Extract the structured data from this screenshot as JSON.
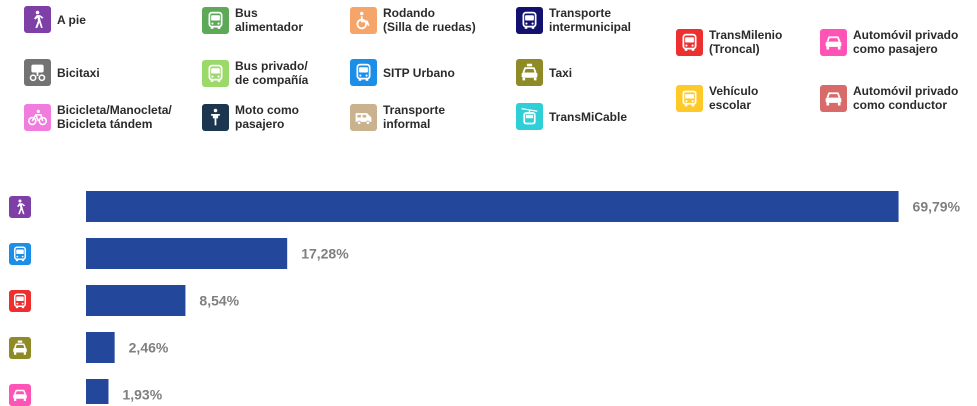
{
  "legend": [
    {
      "label": "A pie",
      "color": "#7e3fa6",
      "icon": "walker-icon"
    },
    {
      "label": "Bus\nalimentador",
      "color": "#5ea957",
      "icon": "bus-icon"
    },
    {
      "label": "Rodando\n(Silla de ruedas)",
      "color": "#f5a56a",
      "icon": "wheelchair-icon"
    },
    {
      "label": "Transporte\nintermunicipal",
      "color": "#121170",
      "icon": "bus-icon"
    },
    {
      "label": "TransMilenio\n(Troncal)",
      "color": "#ee2f2f",
      "icon": "bus-icon"
    },
    {
      "label": "Automóvil privado\ncomo pasajero",
      "color": "#ff54b5",
      "icon": "car-icon"
    },
    {
      "label": "Bicitaxi",
      "color": "#737373",
      "icon": "bicitaxi-icon"
    },
    {
      "label": "Bus privado/\nde compañía",
      "color": "#9bd96a",
      "icon": "bus-icon"
    },
    {
      "label": "SITP Urbano",
      "color": "#1b8ee8",
      "icon": "bus-icon"
    },
    {
      "label": "Taxi",
      "color": "#8e8a25",
      "icon": "taxi-icon"
    },
    {
      "label": "Vehículo\nescolar",
      "color": "#ffc927",
      "icon": "school-bus-icon"
    },
    {
      "label": "Automóvil privado\ncomo conductor",
      "color": "#d96a6a",
      "icon": "car-icon"
    },
    {
      "label": "Bicicleta/Manocleta/\nBicicleta tándem",
      "color": "#f07ddd",
      "icon": "bicycle-icon"
    },
    {
      "label": "Moto como\npasajero",
      "color": "#1d3650",
      "icon": "motorcycle-icon"
    },
    {
      "label": "Transporte\ninformal",
      "color": "#c9b28d",
      "icon": "van-icon"
    },
    {
      "label": "TransMiCable",
      "color": "#2fcfd8",
      "icon": "cable-car-icon"
    }
  ],
  "chart_data": {
    "type": "bar",
    "orientation": "horizontal",
    "categories": [
      "A pie",
      "SITP Urbano",
      "TransMilenio (Troncal)",
      "Taxi",
      "Automóvil privado como pasajero"
    ],
    "values": [
      69.79,
      17.28,
      8.54,
      2.46,
      1.93
    ],
    "value_labels": [
      "69,79%",
      "17,28%",
      "8,54%",
      "2,46%",
      "1,93%"
    ],
    "category_icons": [
      "walker-icon",
      "bus-icon",
      "bus-icon",
      "taxi-icon",
      "car-icon"
    ],
    "category_colors": [
      "#7e3fa6",
      "#1b8ee8",
      "#ee2f2f",
      "#8e8a25",
      "#ff54b5"
    ],
    "bar_color": "#23479a",
    "label_color": "#7f7f7f",
    "xlim": [
      0,
      70
    ],
    "grid": false,
    "title": "",
    "xlabel": "",
    "ylabel": ""
  }
}
